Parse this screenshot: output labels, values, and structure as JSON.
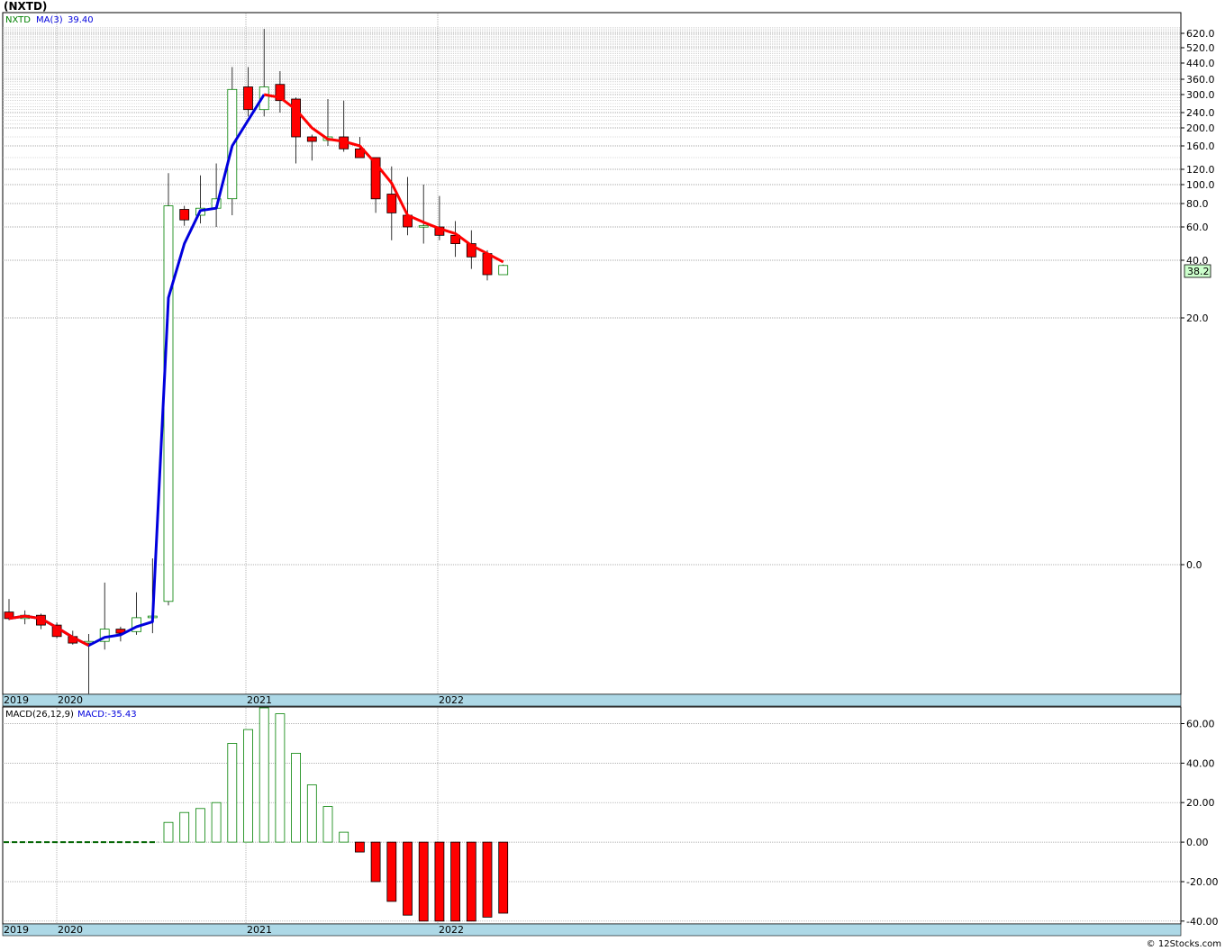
{
  "chart_data": [
    {
      "type": "candlestick",
      "title": "(NXTD)",
      "indicator_label": "NXTD",
      "ma_label": "MA(3)",
      "ma_value": "39.40",
      "last_price_label": "38.2",
      "x_labels": [
        "2019",
        "2020",
        "2021",
        "2022"
      ],
      "y_ticks": [
        "620.0",
        "520.0",
        "440.0",
        "360.0",
        "300.0",
        "240.0",
        "200.0",
        "160.0",
        "120.0",
        "100.0",
        "80.0",
        "60.0",
        "40.0",
        "20.0",
        "0.0"
      ],
      "colors": {
        "up": "#008000",
        "down": "#ff0000",
        "ma_up": "#0000dd",
        "ma_down": "#ff0000",
        "last_bg": "#ccffcc"
      },
      "candles": [
        {
          "o": -5.8,
          "h": -4.2,
          "l": -6.8,
          "c": -6.6,
          "ma": -6.6
        },
        {
          "o": -6.6,
          "h": -5.6,
          "l": -7.3,
          "c": -6.2,
          "ma": -6.3
        },
        {
          "o": -6.2,
          "h": -6.0,
          "l": -7.9,
          "c": -7.4,
          "ma": -6.6
        },
        {
          "o": -7.4,
          "h": -7.1,
          "l": -9.0,
          "c": -8.8,
          "ma": -7.7
        },
        {
          "o": -8.8,
          "h": -8.1,
          "l": -9.8,
          "c": -9.6,
          "ma": -8.9
        },
        {
          "o": -9.6,
          "h": -8.5,
          "l": -15.8,
          "c": -9.4,
          "ma": -9.9
        },
        {
          "o": -9.4,
          "h": -2.2,
          "l": -10.4,
          "c": -7.9,
          "ma": -8.9
        },
        {
          "o": -7.9,
          "h": -7.6,
          "l": -9.4,
          "c": -8.4,
          "ma": -8.6
        },
        {
          "o": -8.2,
          "h": -3.4,
          "l": -8.6,
          "c": -6.5,
          "ma": -7.6
        },
        {
          "o": -6.5,
          "h": 0.5,
          "l": -8.4,
          "c": -6.3,
          "ma": -7.0
        },
        {
          "o": -4.5,
          "h": 115,
          "l": -5.0,
          "c": 78,
          "ma": 27
        },
        {
          "o": 75,
          "h": 78,
          "l": 61,
          "c": 66,
          "ma": 50
        },
        {
          "o": 70,
          "h": 112,
          "l": 63,
          "c": 76,
          "ma": 74
        },
        {
          "o": 76,
          "h": 130,
          "l": 60,
          "c": 85,
          "ma": 76
        },
        {
          "o": 85,
          "h": 420,
          "l": 70,
          "c": 320,
          "ma": 160
        },
        {
          "o": 330,
          "h": 420,
          "l": 230,
          "c": 250,
          "ma": 220
        },
        {
          "o": 250,
          "h": 650,
          "l": 230,
          "c": 330,
          "ma": 300
        },
        {
          "o": 340,
          "h": 400,
          "l": 240,
          "c": 280,
          "ma": 290
        },
        {
          "o": 285,
          "h": 290,
          "l": 130,
          "c": 180,
          "ma": 250
        },
        {
          "o": 180,
          "h": 185,
          "l": 135,
          "c": 170,
          "ma": 200
        },
        {
          "o": 172,
          "h": 285,
          "l": 160,
          "c": 180,
          "ma": 175
        },
        {
          "o": 180,
          "h": 280,
          "l": 150,
          "c": 155,
          "ma": 170
        },
        {
          "o": 155,
          "h": 180,
          "l": 140,
          "c": 140,
          "ma": 160
        },
        {
          "o": 140,
          "h": 135,
          "l": 72,
          "c": 85,
          "ma": 130
        },
        {
          "o": 90,
          "h": 125,
          "l": 52,
          "c": 72,
          "ma": 102
        },
        {
          "o": 70,
          "h": 110,
          "l": 55,
          "c": 60,
          "ma": 70
        },
        {
          "o": 60,
          "h": 100,
          "l": 50,
          "c": 61,
          "ma": 64
        },
        {
          "o": 60,
          "h": 88,
          "l": 52,
          "c": 55,
          "ma": 59
        },
        {
          "o": 55,
          "h": 65,
          "l": 42,
          "c": 50,
          "ma": 56
        },
        {
          "o": 50,
          "h": 58,
          "l": 37,
          "c": 42,
          "ma": 49
        },
        {
          "o": 44,
          "h": 46,
          "l": 33,
          "c": 35,
          "ma": 44
        },
        {
          "o": 35,
          "h": 38.5,
          "l": 35,
          "c": 38.2,
          "ma": 39.4
        }
      ]
    },
    {
      "type": "bar",
      "indicator_label": "MACD(26,12,9)",
      "value_label": "MACD:-35.43",
      "x_labels": [
        "2019",
        "2020",
        "2021",
        "2022"
      ],
      "y_ticks": [
        "60.00",
        "40.00",
        "20.00",
        "0.00",
        "-20.00",
        "-40.00"
      ],
      "ylim": [
        -41,
        68
      ],
      "colors": {
        "positive": "#008000",
        "negative": "#ff0000",
        "zero": "#006400"
      },
      "values": [
        0,
        0,
        0,
        0,
        0,
        0,
        0,
        0,
        0,
        0,
        10,
        15,
        17,
        20,
        50,
        57,
        68,
        65,
        45,
        29,
        18,
        5,
        -5,
        -20,
        -30,
        -37,
        -40,
        -40,
        -40,
        -40,
        -38,
        -36
      ]
    }
  ],
  "footer": {
    "copyright": "© 12Stocks.com"
  }
}
